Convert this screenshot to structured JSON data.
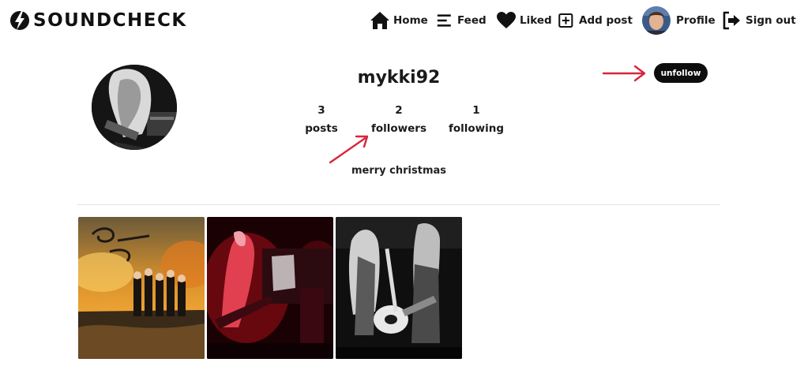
{
  "brand": {
    "name": "SOUNDCHECK"
  },
  "nav": {
    "home": {
      "label": "Home",
      "icon": "home-icon"
    },
    "feed": {
      "label": "Feed",
      "icon": "menu-icon"
    },
    "liked": {
      "label": "Liked",
      "icon": "heart-icon"
    },
    "add_post": {
      "label": "Add post",
      "icon": "plus-square-icon"
    },
    "profile": {
      "label": "Profile",
      "icon": "avatar"
    },
    "sign_out": {
      "label": "Sign out",
      "icon": "sign-out-icon"
    }
  },
  "profile": {
    "username": "mykki92",
    "bio": "merry christmas",
    "stats": {
      "posts": {
        "count": "3",
        "label": "posts"
      },
      "followers": {
        "count": "2",
        "label": "followers"
      },
      "following": {
        "count": "1",
        "label": "following"
      }
    },
    "unfollow_label": "unfollow"
  },
  "posts": [
    {
      "description": "Beggars album cover with band in fiery landscape"
    },
    {
      "description": "Red-lit live concert photo"
    },
    {
      "description": "Black and white guitarists on stage"
    }
  ],
  "colors": {
    "accent_arrow": "#d7263d",
    "button_bg": "#0d0d0d",
    "divider": "#e3e3e3"
  }
}
